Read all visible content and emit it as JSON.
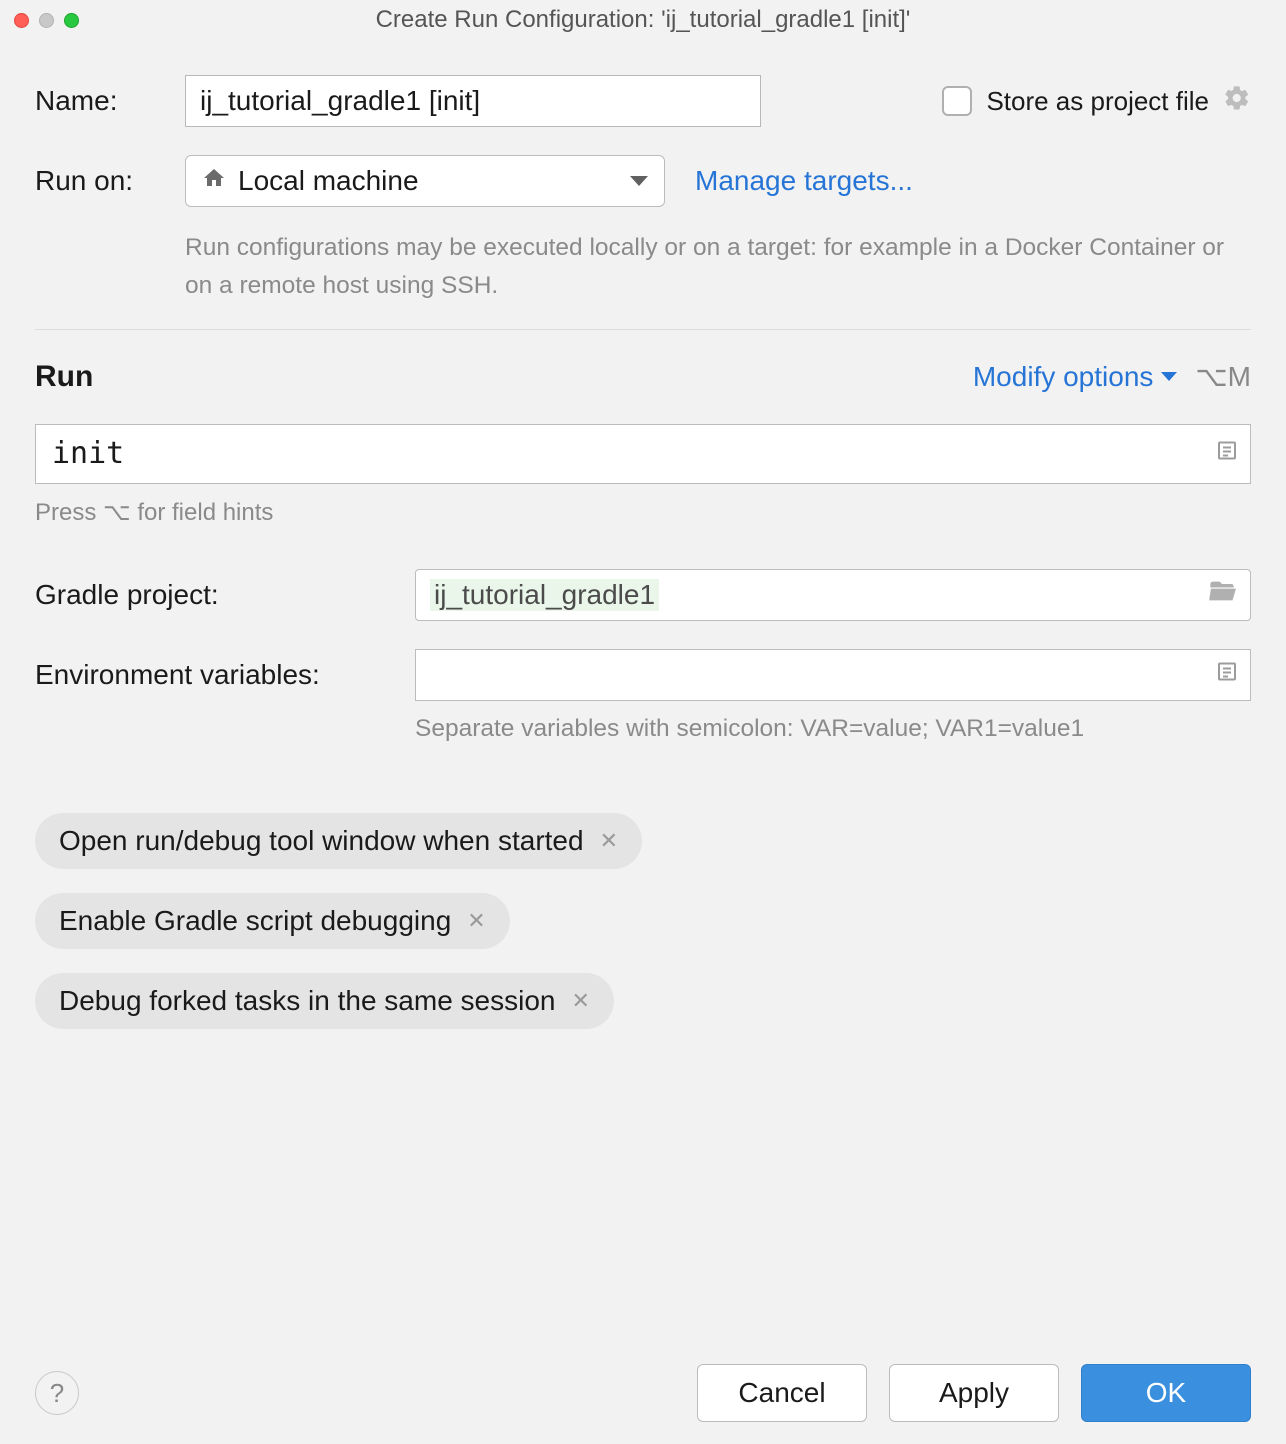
{
  "window": {
    "title": "Create Run Configuration: 'ij_tutorial_gradle1 [init]'"
  },
  "name": {
    "label": "Name:",
    "value": "ij_tutorial_gradle1 [init]"
  },
  "store_as_file": {
    "label": "Store as project file",
    "checked": false
  },
  "run_on": {
    "label": "Run on:",
    "value": "Local machine",
    "manage_link": "Manage targets...",
    "hint": "Run configurations may be executed locally or on a target: for example in a Docker Container or on a remote host using SSH."
  },
  "run_section": {
    "title": "Run",
    "modify_label": "Modify options",
    "shortcut": "⌥M",
    "task_value": "init",
    "task_hint": "Press ⌥ for field hints"
  },
  "gradle_project": {
    "label": "Gradle project:",
    "value": "ij_tutorial_gradle1"
  },
  "env_vars": {
    "label": "Environment variables:",
    "value": "",
    "hint": "Separate variables with semicolon: VAR=value; VAR1=value1"
  },
  "chips": [
    "Open run/debug tool window when started",
    "Enable Gradle script debugging",
    "Debug forked tasks in the same session"
  ],
  "footer": {
    "cancel": "Cancel",
    "apply": "Apply",
    "ok": "OK"
  }
}
